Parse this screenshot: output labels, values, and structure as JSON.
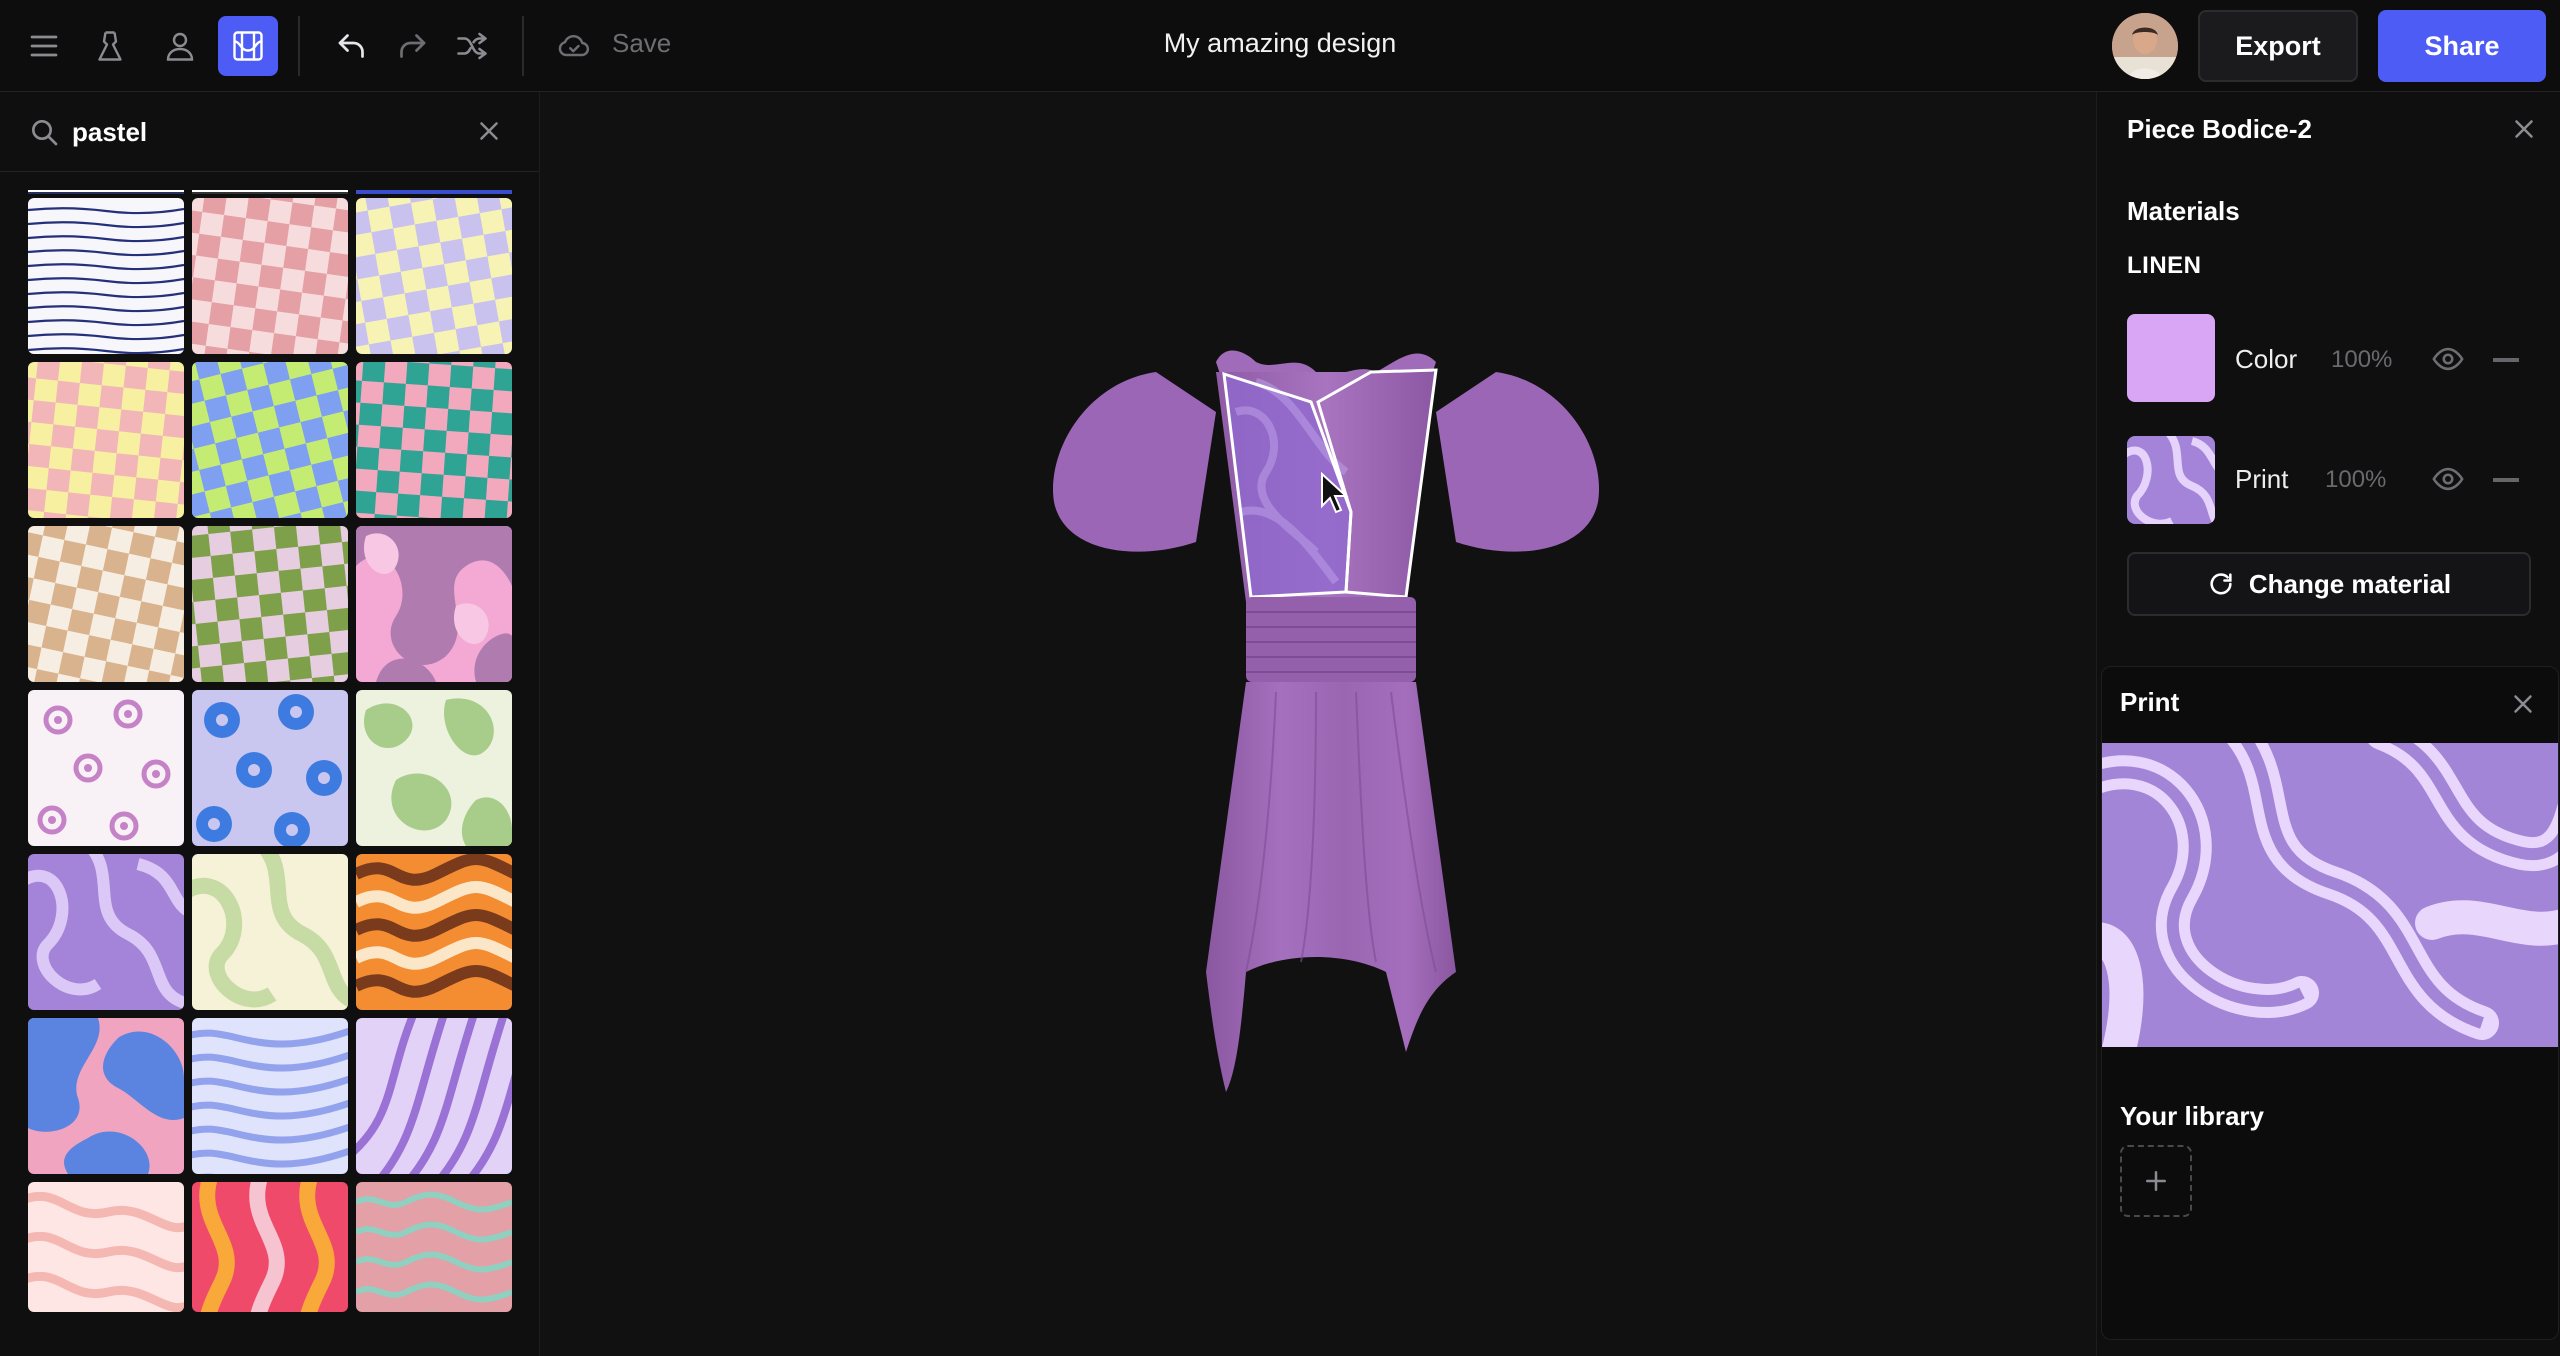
{
  "topbar": {
    "title": "My amazing design",
    "save_label": "Save",
    "export_label": "Export",
    "share_label": "Share",
    "icons": [
      "menu-icon",
      "dress-icon",
      "avatar-icon",
      "pattern-icon",
      "undo-icon",
      "redo-icon",
      "shuffle-icon",
      "cloud-icon"
    ],
    "accent_color": "#4c5cf4"
  },
  "sidebar": {
    "search": {
      "value": "pastel",
      "placeholder": ""
    },
    "patterns": [
      "navy-stripes",
      "pink-checker",
      "lavender-yellow-checker",
      "pink-yellow-checker",
      "lime-blue-checker",
      "teal-pink-checker",
      "tan-checker",
      "green-pink-checker",
      "pink-mauve-blobs",
      "lilac-flowers",
      "blue-flowers",
      "sage-blobs",
      "purple-swirl",
      "sage-cream-swirl",
      "orange-brown-waves",
      "blue-pink-blobs",
      "blue-zebra",
      "purple-zebra",
      "pink-cream-waves",
      "red-orange-waves",
      "mint-pink-waves"
    ]
  },
  "panel": {
    "piece_title": "Piece Bodice-2",
    "materials_heading": "Materials",
    "material_name": "LINEN",
    "layers": [
      {
        "label": "Color",
        "percent": "100%",
        "swatch": "#d9a6f5"
      },
      {
        "label": "Print",
        "percent": "100%",
        "swatch": "purple-swirl"
      }
    ],
    "change_material_label": "Change material",
    "print_heading": "Print",
    "library_heading": "Your library"
  }
}
